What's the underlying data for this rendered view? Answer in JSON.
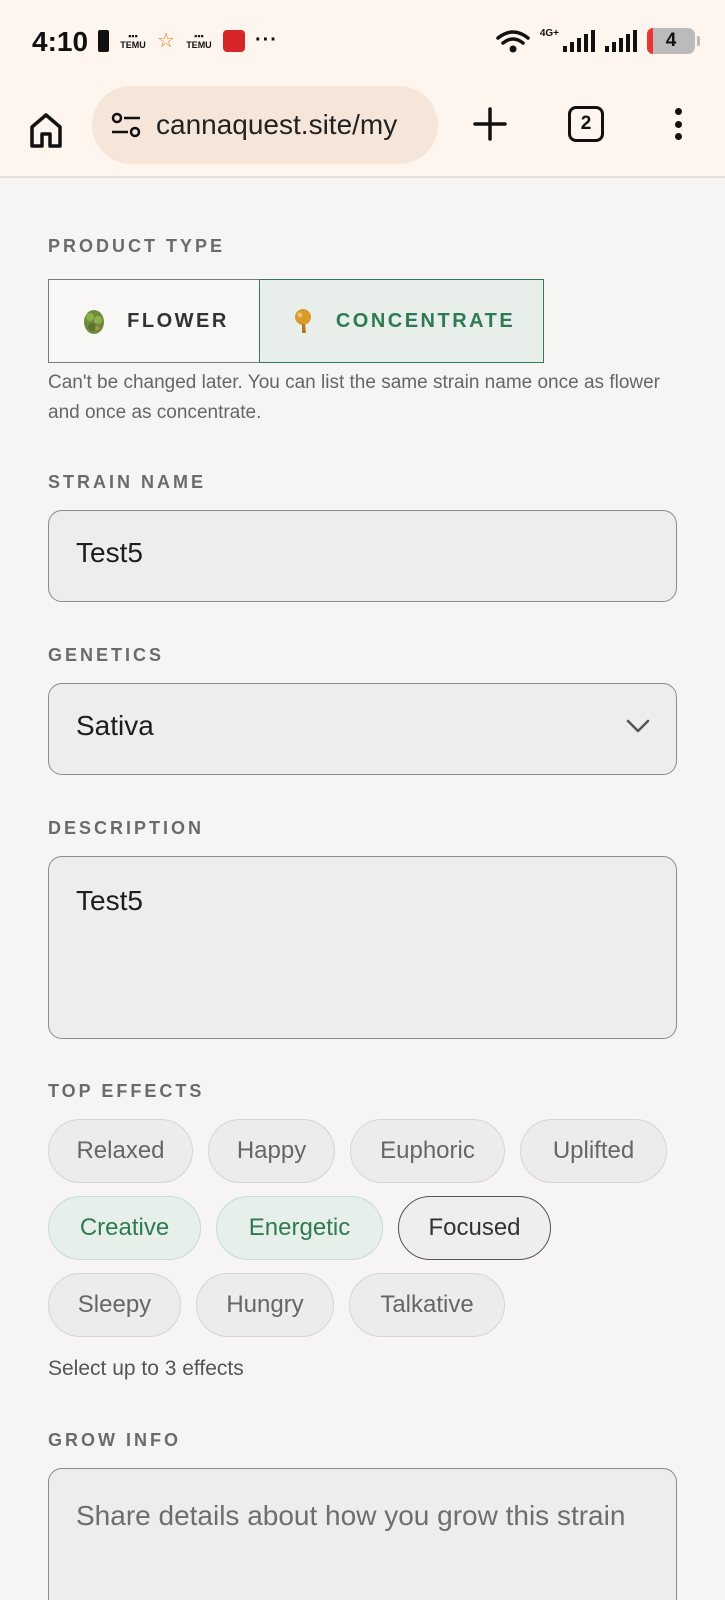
{
  "status_bar": {
    "time": "4:10",
    "temu_label": "TEMU",
    "network": "4G+",
    "battery": "4"
  },
  "browser": {
    "url": "cannaquest.site/my",
    "tab_count": "2"
  },
  "form": {
    "product_type": {
      "label": "PRODUCT TYPE",
      "options": [
        "FLOWER",
        "CONCENTRATE"
      ],
      "selected": "CONCENTRATE",
      "helper": "Can't be changed later. You can list the same strain name once as flower and once as concentrate."
    },
    "strain_name": {
      "label": "STRAIN NAME",
      "value": "Test5"
    },
    "genetics": {
      "label": "GENETICS",
      "value": "Sativa"
    },
    "description": {
      "label": "DESCRIPTION",
      "value": "Test5"
    },
    "top_effects": {
      "label": "TOP EFFECTS",
      "chips": [
        "Relaxed",
        "Happy",
        "Euphoric",
        "Uplifted",
        "Creative",
        "Energetic",
        "Focused",
        "Sleepy",
        "Hungry",
        "Talkative"
      ],
      "selected": [
        "Creative",
        "Energetic"
      ],
      "helper": "Select up to 3 effects"
    },
    "grow_info": {
      "label": "GROW INFO",
      "placeholder": "Share details about how you grow this strain"
    }
  },
  "colors": {
    "accent_green": "#2f7a52",
    "browser_bar": "#fdf5ee",
    "page_bg": "#f6f5f3"
  }
}
